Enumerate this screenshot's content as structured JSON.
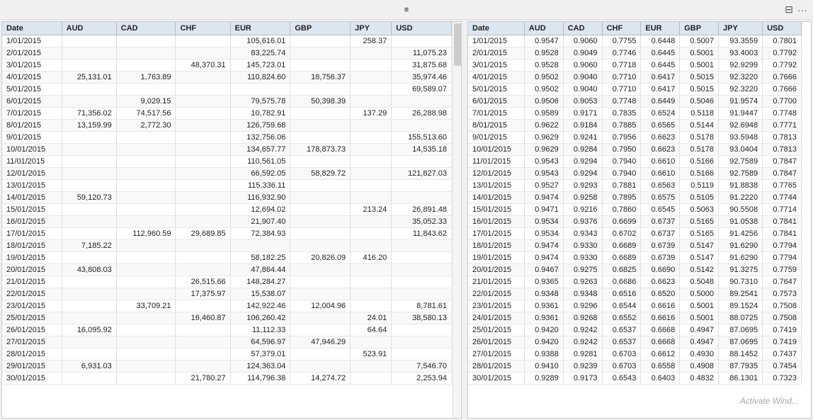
{
  "titleBar": {
    "controls": [
      "⊟",
      "···"
    ]
  },
  "leftTable": {
    "headers": [
      "Date",
      "AUD",
      "CAD",
      "CHF",
      "EUR",
      "GBP",
      "JPY",
      "USD"
    ],
    "rows": [
      [
        "1/01/2015",
        "",
        "",
        "",
        "105,616.01",
        "",
        "258.37",
        ""
      ],
      [
        "2/01/2015",
        "",
        "",
        "",
        "83,225.74",
        "",
        "",
        "11,075.23"
      ],
      [
        "3/01/2015",
        "",
        "",
        "48,370.31",
        "145,723.01",
        "",
        "",
        "31,875.68"
      ],
      [
        "4/01/2015",
        "25,131.01",
        "1,763.89",
        "",
        "110,824.60",
        "18,756.37",
        "",
        "35,974.46"
      ],
      [
        "5/01/2015",
        "",
        "",
        "",
        "",
        "",
        "",
        "69,589.07"
      ],
      [
        "6/01/2015",
        "",
        "9,029.15",
        "",
        "79,575.78",
        "50,398.39",
        "",
        ""
      ],
      [
        "7/01/2015",
        "71,356.02",
        "74,517.56",
        "",
        "10,782.91",
        "",
        "137.29",
        "26,288.98"
      ],
      [
        "8/01/2015",
        "13,159.99",
        "2,772.30",
        "",
        "126,759.68",
        "",
        "",
        ""
      ],
      [
        "9/01/2015",
        "",
        "",
        "",
        "132,756.06",
        "",
        "",
        "155,513.60"
      ],
      [
        "10/01/2015",
        "",
        "",
        "",
        "134,657.77",
        "178,873.73",
        "",
        "14,535.18"
      ],
      [
        "11/01/2015",
        "",
        "",
        "",
        "110,561.05",
        "",
        "",
        ""
      ],
      [
        "12/01/2015",
        "",
        "",
        "",
        "66,592.05",
        "58,829.72",
        "",
        "121,827.03"
      ],
      [
        "13/01/2015",
        "",
        "",
        "",
        "115,336.11",
        "",
        "",
        ""
      ],
      [
        "14/01/2015",
        "59,120.73",
        "",
        "",
        "116,932.90",
        "",
        "",
        ""
      ],
      [
        "15/01/2015",
        "",
        "",
        "",
        "12,694.02",
        "",
        "213.24",
        "26,891.48"
      ],
      [
        "16/01/2015",
        "",
        "",
        "",
        "21,907.40",
        "",
        "",
        "35,052.33"
      ],
      [
        "17/01/2015",
        "",
        "112,960.59",
        "29,689.85",
        "72,384.93",
        "",
        "",
        "11,843.62"
      ],
      [
        "18/01/2015",
        "7,185.22",
        "",
        "",
        "",
        "",
        "",
        ""
      ],
      [
        "19/01/2015",
        "",
        "",
        "",
        "58,182.25",
        "20,826.09",
        "416.20",
        ""
      ],
      [
        "20/01/2015",
        "43,808.03",
        "",
        "",
        "47,864.44",
        "",
        "",
        ""
      ],
      [
        "21/01/2015",
        "",
        "",
        "26,515.66",
        "148,284.27",
        "",
        "",
        ""
      ],
      [
        "22/01/2015",
        "",
        "",
        "17,375.97",
        "15,538.07",
        "",
        "",
        ""
      ],
      [
        "23/01/2015",
        "",
        "33,709.21",
        "",
        "142,922.46",
        "12,004.96",
        "",
        "8,781.61"
      ],
      [
        "25/01/2015",
        "",
        "",
        "16,460.87",
        "106,260.42",
        "",
        "24.01",
        "38,580.13"
      ],
      [
        "26/01/2015",
        "16,095.92",
        "",
        "",
        "11,112.33",
        "",
        "64.64",
        ""
      ],
      [
        "27/01/2015",
        "",
        "",
        "",
        "64,596.97",
        "47,946.29",
        "",
        ""
      ],
      [
        "28/01/2015",
        "",
        "",
        "",
        "57,379.01",
        "",
        "523.91",
        ""
      ],
      [
        "29/01/2015",
        "6,931.03",
        "",
        "",
        "124,363.04",
        "",
        "",
        "7,546.70"
      ],
      [
        "30/01/2015",
        "",
        "",
        "21,780.27",
        "114,796.38",
        "14,274.72",
        "",
        "2,253.94"
      ]
    ]
  },
  "rightTable": {
    "headers": [
      "Date",
      "AUD",
      "CAD",
      "CHF",
      "EUR",
      "GBP",
      "JPY",
      "USD"
    ],
    "rows": [
      [
        "1/01/2015",
        "0.9547",
        "0.9060",
        "0.7755",
        "0.6448",
        "0.5007",
        "93.3559",
        "0.7801"
      ],
      [
        "2/01/2015",
        "0.9528",
        "0.9049",
        "0.7746",
        "0.6445",
        "0.5001",
        "93.4003",
        "0.7792"
      ],
      [
        "3/01/2015",
        "0.9528",
        "0.9060",
        "0.7718",
        "0.6445",
        "0.5001",
        "92.9299",
        "0.7792"
      ],
      [
        "4/01/2015",
        "0.9502",
        "0.9040",
        "0.7710",
        "0.6417",
        "0.5015",
        "92.3220",
        "0.7666"
      ],
      [
        "5/01/2015",
        "0.9502",
        "0.9040",
        "0.7710",
        "0.6417",
        "0.5015",
        "92.3220",
        "0.7666"
      ],
      [
        "6/01/2015",
        "0.9506",
        "0.9053",
        "0.7748",
        "0.6449",
        "0.5046",
        "91.9574",
        "0.7700"
      ],
      [
        "7/01/2015",
        "0.9589",
        "0.9171",
        "0.7835",
        "0.6524",
        "0.5118",
        "91.9447",
        "0.7748"
      ],
      [
        "8/01/2015",
        "0.9622",
        "0.9184",
        "0.7885",
        "0.6565",
        "0.5144",
        "92.6948",
        "0.7771"
      ],
      [
        "9/01/2015",
        "0.9629",
        "0.9241",
        "0.7956",
        "0.6623",
        "0.5178",
        "93.5948",
        "0.7813"
      ],
      [
        "10/01/2015",
        "0.9629",
        "0.9284",
        "0.7950",
        "0.6623",
        "0.5178",
        "93.0404",
        "0.7813"
      ],
      [
        "11/01/2015",
        "0.9543",
        "0.9294",
        "0.7940",
        "0.6610",
        "0.5166",
        "92.7589",
        "0.7847"
      ],
      [
        "12/01/2015",
        "0.9543",
        "0.9294",
        "0.7940",
        "0.6610",
        "0.5166",
        "92.7589",
        "0.7847"
      ],
      [
        "13/01/2015",
        "0.9527",
        "0.9293",
        "0.7881",
        "0.6563",
        "0.5119",
        "91.8838",
        "0.7765"
      ],
      [
        "14/01/2015",
        "0.9474",
        "0.9258",
        "0.7895",
        "0.6575",
        "0.5105",
        "91.2220",
        "0.7744"
      ],
      [
        "15/01/2015",
        "0.9471",
        "0.9216",
        "0.7860",
        "0.6545",
        "0.5063",
        "90.5508",
        "0.7714"
      ],
      [
        "16/01/2015",
        "0.9534",
        "0.9376",
        "0.6699",
        "0.6737",
        "0.5165",
        "91.0538",
        "0.7841"
      ],
      [
        "17/01/2015",
        "0.9534",
        "0.9343",
        "0.6702",
        "0.6737",
        "0.5165",
        "91.4256",
        "0.7841"
      ],
      [
        "18/01/2015",
        "0.9474",
        "0.9330",
        "0.6689",
        "0.6739",
        "0.5147",
        "91.6290",
        "0.7794"
      ],
      [
        "19/01/2015",
        "0.9474",
        "0.9330",
        "0.6689",
        "0.6739",
        "0.5147",
        "91.6290",
        "0.7794"
      ],
      [
        "20/01/2015",
        "0.9467",
        "0.9275",
        "0.6825",
        "0.6690",
        "0.5142",
        "91.3275",
        "0.7759"
      ],
      [
        "21/01/2015",
        "0.9365",
        "0.9263",
        "0.6686",
        "0.6623",
        "0.5048",
        "90.7310",
        "0.7647"
      ],
      [
        "22/01/2015",
        "0.9348",
        "0.9348",
        "0.6516",
        "0.6520",
        "0.5000",
        "89.2541",
        "0.7573"
      ],
      [
        "23/01/2015",
        "0.9361",
        "0.9296",
        "0.6544",
        "0.6616",
        "0.5001",
        "89.1524",
        "0.7508"
      ],
      [
        "24/01/2015",
        "0.9361",
        "0.9268",
        "0.6552",
        "0.6616",
        "0.5001",
        "88.0725",
        "0.7508"
      ],
      [
        "25/01/2015",
        "0.9420",
        "0.9242",
        "0.6537",
        "0.6668",
        "0.4947",
        "87.0695",
        "0.7419"
      ],
      [
        "26/01/2015",
        "0.9420",
        "0.9242",
        "0.6537",
        "0.6668",
        "0.4947",
        "87.0695",
        "0.7419"
      ],
      [
        "27/01/2015",
        "0.9388",
        "0.9281",
        "0.6703",
        "0.6612",
        "0.4930",
        "88.1452",
        "0.7437"
      ],
      [
        "28/01/2015",
        "0.9410",
        "0.9239",
        "0.6703",
        "0.6558",
        "0.4908",
        "87.7935",
        "0.7454"
      ],
      [
        "30/01/2015",
        "0.9289",
        "0.9173",
        "0.6543",
        "0.6403",
        "0.4832",
        "86.1301",
        "0.7323"
      ]
    ]
  },
  "watermark": "Activate Wind..."
}
